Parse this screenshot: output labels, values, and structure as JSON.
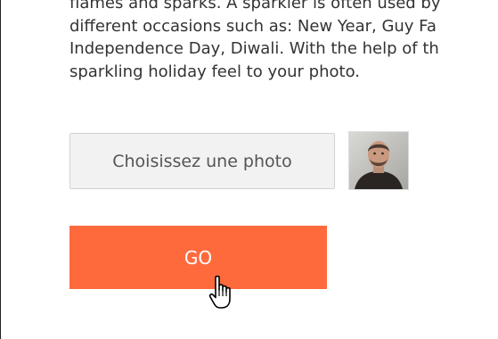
{
  "description": {
    "line1": "flames and sparks. A sparkler is often used by",
    "line2": "different occasions such as: New Year, Guy Fa",
    "line3": "Independence Day, Diwali. With the help of th",
    "line4": "sparkling holiday feel to your photo."
  },
  "upload": {
    "choose_label": "Choisissez une photo",
    "thumbnail_icon": "user-photo-thumbnail"
  },
  "submit": {
    "go_label": "GO",
    "color": "#ff6a3d"
  },
  "cursor": {
    "icon": "hand-pointer-cursor"
  }
}
